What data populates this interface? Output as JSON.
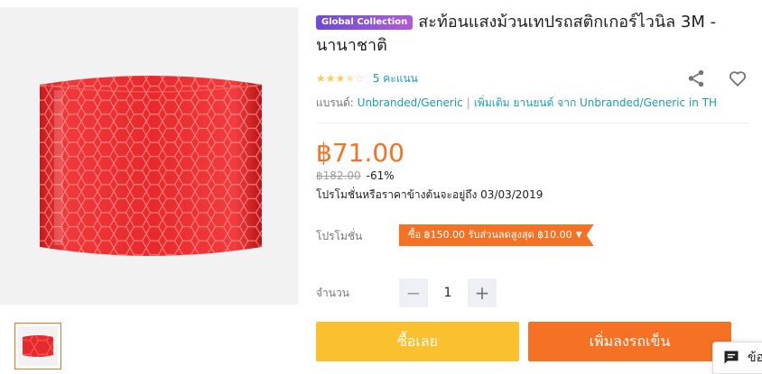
{
  "product": {
    "badge": "Global Collection",
    "title": "สะท้อนแสงม้วนเทปรถสติกเกอร์ไวนิล 3M - นานาชาติ",
    "rating_value": 3.5,
    "rating_stars_filled": "★★★",
    "rating_stars_half": "★",
    "rating_stars_empty": "☆",
    "rating_count": "5 คะแนน",
    "brand_label": "แบรนด์:",
    "brand_name": "Unbranded/Generic",
    "more_link": "เพิ่มเติม ยานยนต์ จาก Unbranded/Generic in TH"
  },
  "pricing": {
    "price": "฿71.00",
    "old_price": "฿182.00",
    "discount": "-61%",
    "promo_until": "โปรโมชั่นหรือราคาข้างต้นจะอยู่ถึง 03/03/2019"
  },
  "promotion": {
    "label": "โปรโมชั่น",
    "voucher": "ซื้อ ฿150.00 รับส่วนลดสูงสุด ฿10.00",
    "caret": "▼"
  },
  "quantity": {
    "label": "จำนวน",
    "minus": "−",
    "value": "1",
    "plus": "+"
  },
  "actions": {
    "buy_now": "ซื้อเลย",
    "add_to_cart": "เพิ่มลงรถเข็น"
  },
  "chat": {
    "label": "ข้อ"
  },
  "icons": {
    "share": "share-icon",
    "wishlist": "heart-icon",
    "chat": "chat-icon"
  },
  "colors": {
    "accent": "#f57224",
    "buy_now": "#fbc02d",
    "link": "#1a9cb7",
    "star": "#faca51",
    "product_red": "#e8292b"
  }
}
